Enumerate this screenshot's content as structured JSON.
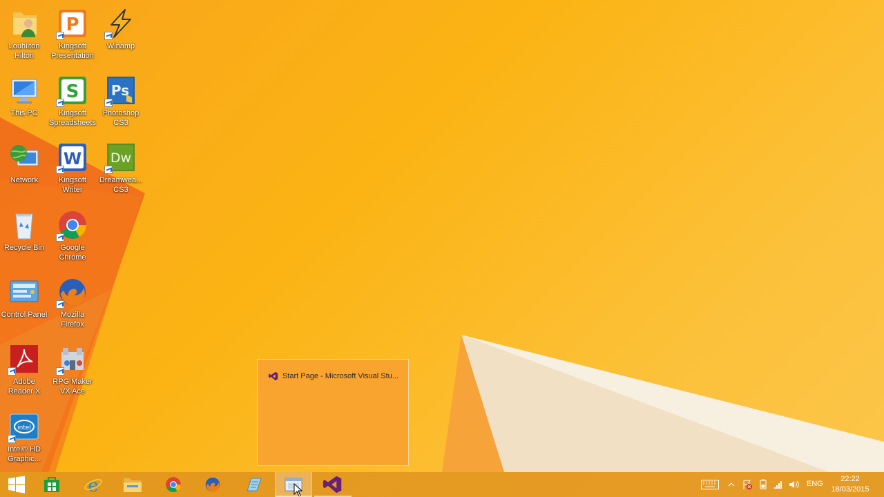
{
  "desktop": {
    "icons": [
      {
        "id": "louhilton",
        "label": "Louhilton Hilton",
        "icon": "user-folder-icon"
      },
      {
        "id": "kingsoft-presentation",
        "label": "Kingsoft Presentation",
        "icon": "kingsoft-presentation-icon"
      },
      {
        "id": "winamp",
        "label": "Winamp",
        "icon": "winamp-icon"
      },
      {
        "id": "this-pc",
        "label": "This PC",
        "icon": "computer-icon"
      },
      {
        "id": "kingsoft-spreadsheets",
        "label": "Kingsoft Spreadsheets",
        "icon": "kingsoft-spreadsheets-icon"
      },
      {
        "id": "photoshop",
        "label": "Photoshop CS3",
        "icon": "photoshop-icon"
      },
      {
        "id": "network",
        "label": "Network",
        "icon": "network-globe-icon"
      },
      {
        "id": "kingsoft-writer",
        "label": "Kingsoft Writer",
        "icon": "kingsoft-writer-icon"
      },
      {
        "id": "dreamweaver",
        "label": "Dreamwea... CS3",
        "icon": "dreamweaver-icon"
      },
      {
        "id": "recycle-bin",
        "label": "Recycle Bin",
        "icon": "recycle-bin-icon"
      },
      {
        "id": "google-chrome",
        "label": "Google Chrome",
        "icon": "chrome-icon"
      },
      {
        "id": "control-panel",
        "label": "Control Panel",
        "icon": "control-panel-icon"
      },
      {
        "id": "mozilla-firefox",
        "label": "Mozilla Firefox",
        "icon": "firefox-icon"
      },
      {
        "id": "adobe-reader",
        "label": "Adobe Reader X",
        "icon": "adobe-reader-icon"
      },
      {
        "id": "rpg-maker",
        "label": "RPG Maker VX Ace",
        "icon": "rpg-maker-icon"
      },
      {
        "id": "intel-hd",
        "label": "Intel® HD Graphic...",
        "icon": "intel-graphics-icon"
      }
    ]
  },
  "thumbnail_popup": {
    "title": "Start Page - Microsoft Visual Stu...",
    "icon": "visual-studio-icon"
  },
  "taskbar": {
    "items": [
      {
        "name": "start-button",
        "icon": "windows-logo-icon"
      },
      {
        "name": "store",
        "icon": "store-icon"
      },
      {
        "name": "internet-explorer",
        "icon": "internet-explorer-icon"
      },
      {
        "name": "file-explorer",
        "icon": "file-explorer-icon"
      },
      {
        "name": "chrome",
        "icon": "chrome-icon"
      },
      {
        "name": "firefox",
        "icon": "firefox-icon"
      },
      {
        "name": "notepad",
        "icon": "notepad-icon"
      },
      {
        "name": "virtual-machine",
        "icon": "window-app-icon"
      },
      {
        "name": "visual-studio",
        "icon": "visual-studio-icon"
      }
    ],
    "tray": {
      "icons": [
        "keyboard-icon",
        "show-hidden-icons-chevron",
        "action-center-flag-icon",
        "power-icon",
        "network-signal-icon",
        "volume-icon"
      ],
      "language": "ENG",
      "time": "22:22",
      "date": "18/03/2015"
    }
  },
  "colors": {
    "wallpaper": "#fbb414",
    "taskbar": "#de911e",
    "popup": "#f9a42e"
  }
}
